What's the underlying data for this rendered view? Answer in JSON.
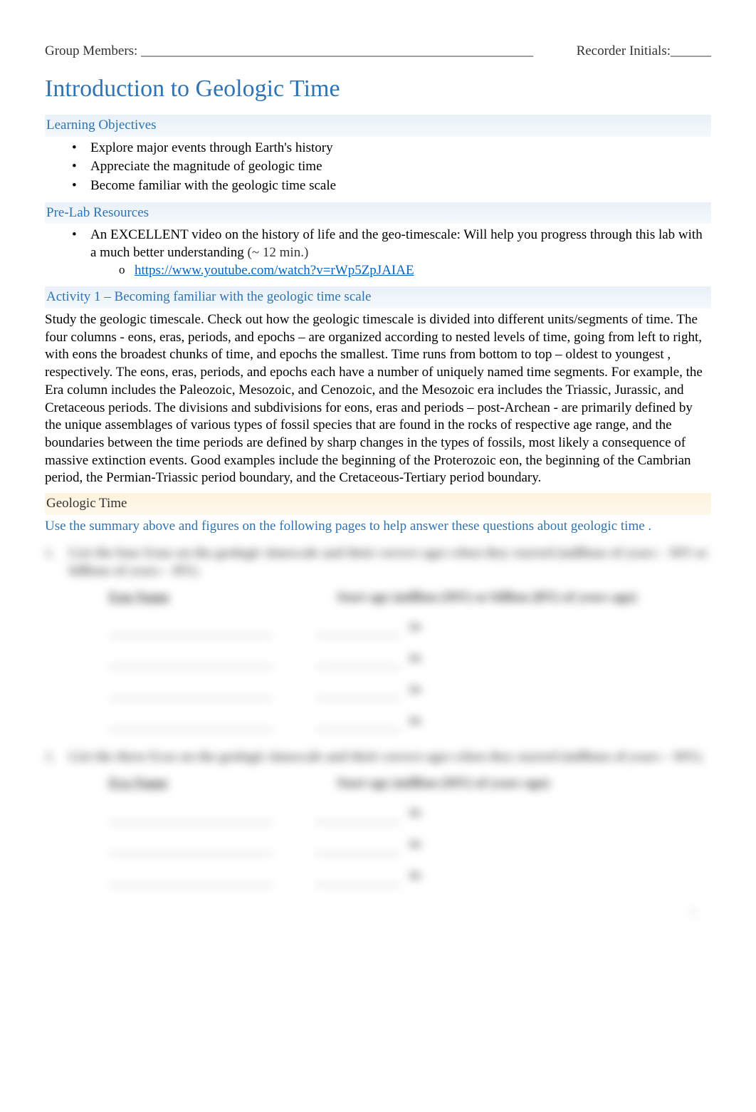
{
  "header": {
    "group_members_label": "Group Members: __________________________________________________________",
    "recorder_label": "Recorder Initials:______"
  },
  "title": "Introduction to Geologic Time",
  "learning_objectives": {
    "heading": "Learning Objectives",
    "items": [
      "Explore major events through Earth's history",
      "Appreciate the magnitude of geologic time",
      "Become familiar with the geologic time scale"
    ]
  },
  "prelab": {
    "heading": "Pre-Lab Resources",
    "item_text": "An EXCELLENT video on the history of life and the geo-timescale: Will help you progress through this lab with a much better understanding",
    "duration_note": "(~ 12 min.)",
    "video_url": "https://www.youtube.com/watch?v=rWp5ZpJAIAE"
  },
  "activity1": {
    "heading": "Activity 1 – Becoming familiar with the geologic time scale",
    "body": "Study the geologic timescale. Check out how the geologic timescale is divided into different units/segments of time. The four columns - eons, eras, periods, and epochs – are organized according to nested levels of time, going from left to right, with eons the broadest chunks of time, and epochs the smallest. Time runs from   bottom to top – oldest to youngest   , respectively. The eons, eras, periods, and epochs each have a number of uniquely named time segments. For example, the Era column includes the Paleozoic, Mesozoic, and Cenozoic, and the Mesozoic era includes the Triassic, Jurassic, and Cretaceous periods.  The divisions and subdivisions for eons, eras and periods – post-Archean - are primarily defined by the unique assemblages of various types of fossil species    that are found in the rocks of respective age range, and the boundaries between the time periods are defined by sharp changes in the types of fossils,       most likely a consequence of massive extinction events. Good examples include the beginning of the Proterozoic eon, the beginning of the Cambrian period, the Permian-Triassic period boundary, and the Cretaceous-Tertiary period boundary."
  },
  "geotime": {
    "heading": "Geologic Time",
    "instruction": "Use the summary above and figures on the following pages to help answer these questions about geologic time       ."
  },
  "blurred": {
    "q1": {
      "num": "1.",
      "text": "List the four Eons on the geologic timescale and their correct ages when they started (millions of years – MY or billions of years – BY).",
      "col1_head": "Eon Name",
      "col2_head": "Start age (million (MY) or billion (BY) of years ago)",
      "row_count": 4
    },
    "q2": {
      "num": "2.",
      "text": "List the three Eras on the geologic timescale and their correct ages when they started (millions of years – MY).",
      "col1_head": "Era Name",
      "col2_head": "Start age (million (MY) of years ago)",
      "row_count": 3
    }
  },
  "page_number": "1"
}
